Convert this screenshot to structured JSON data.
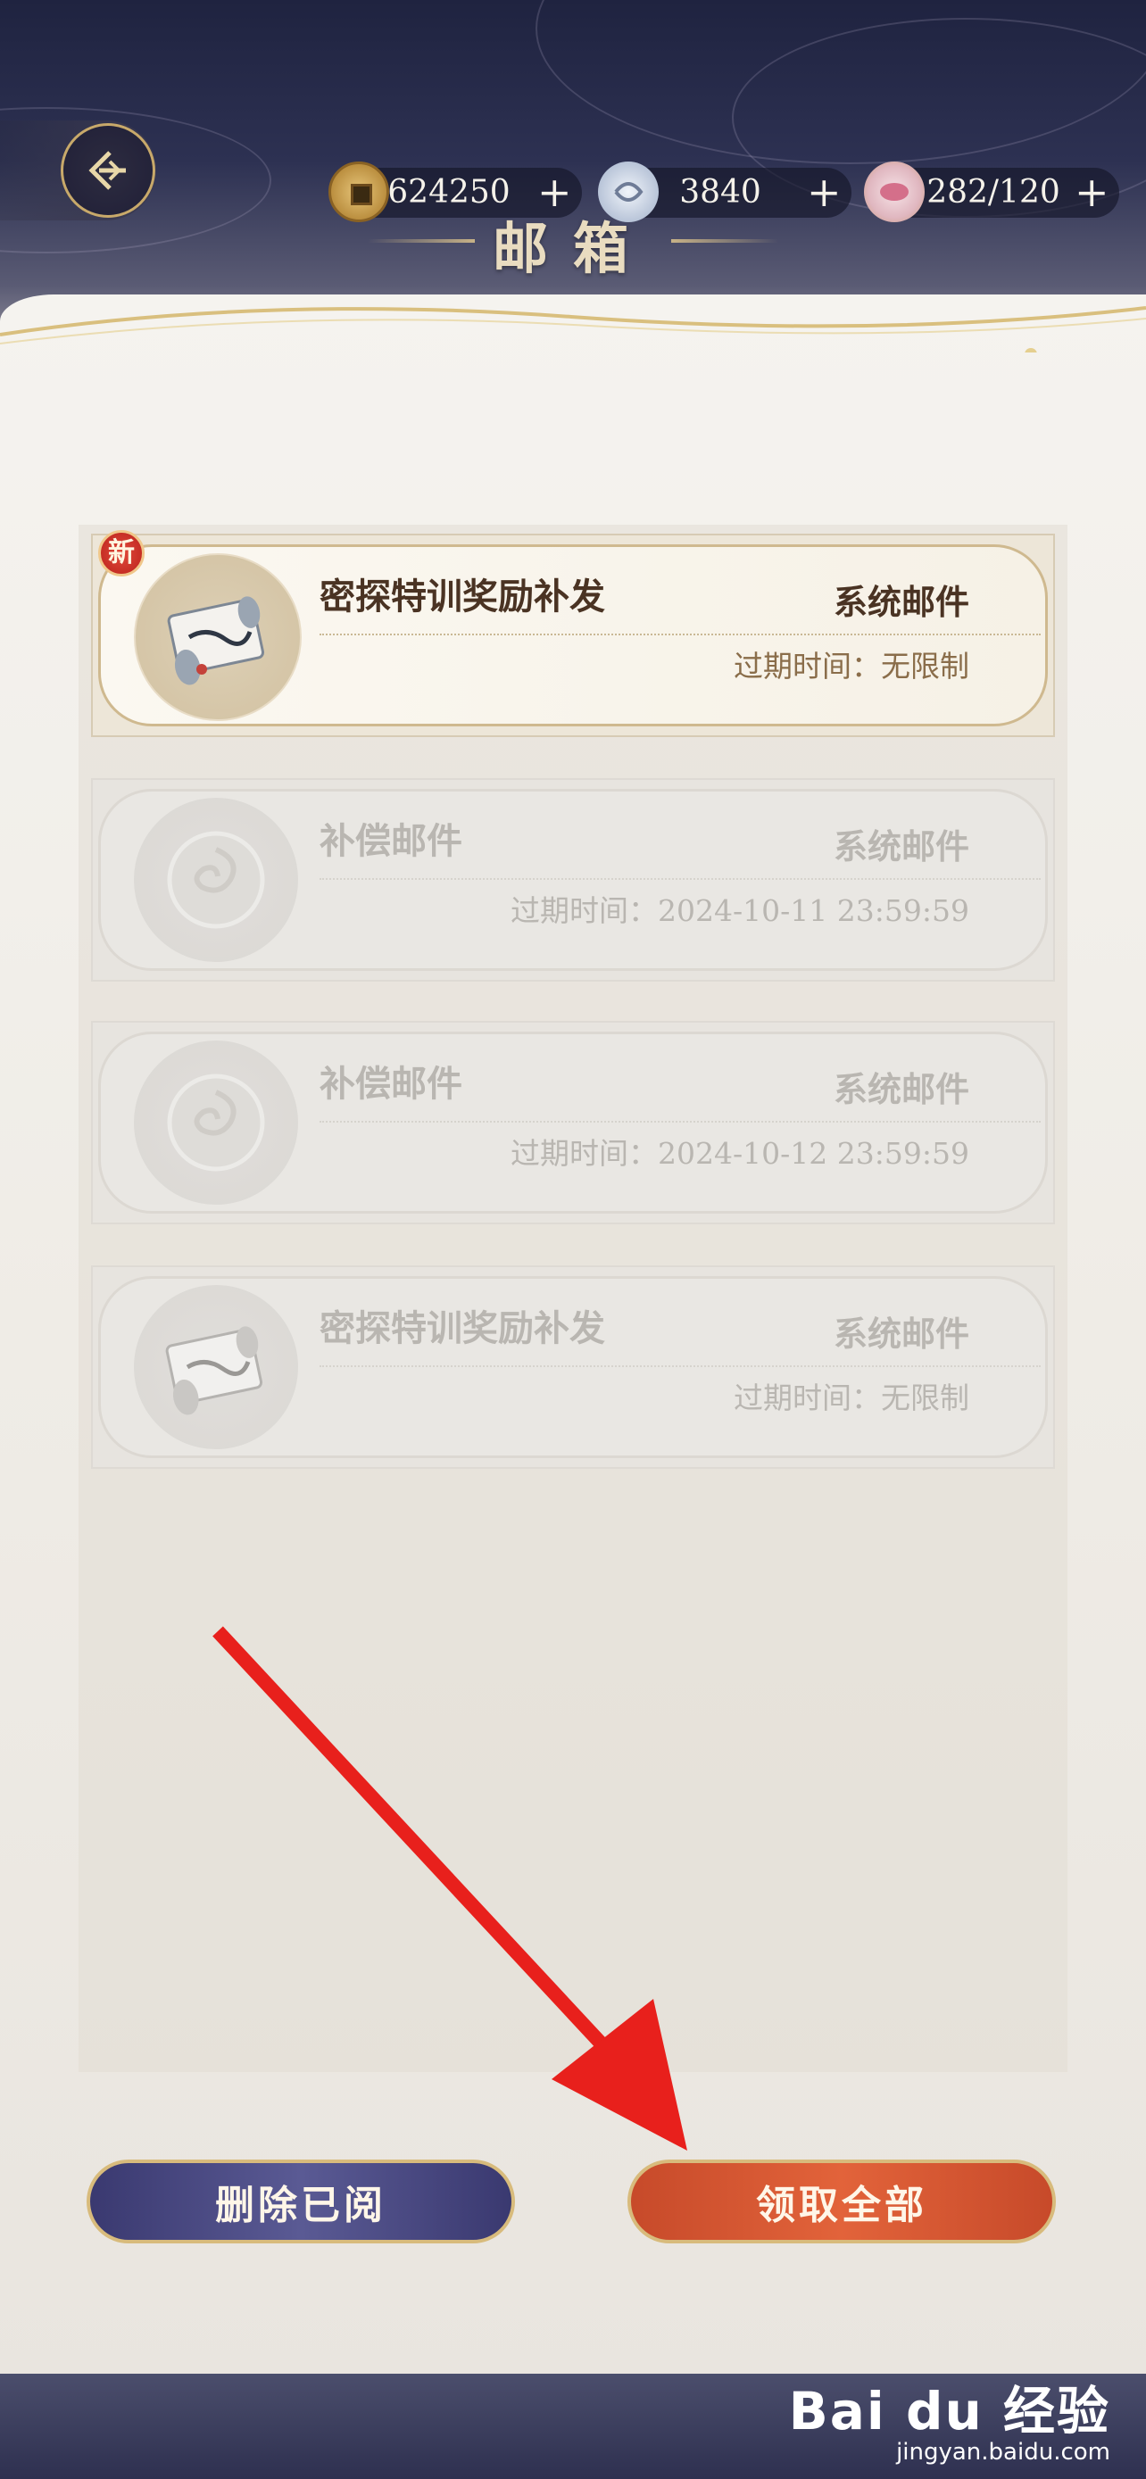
{
  "header": {
    "title": "邮箱",
    "resources": [
      {
        "icon": "copper-coin-icon",
        "value": "624250"
      },
      {
        "icon": "silver-jade-icon",
        "value": "3840"
      },
      {
        "icon": "stamina-bowl-icon",
        "value": "282/120"
      }
    ]
  },
  "mails": [
    {
      "title": "密探特训奖励补发",
      "type": "系统邮件",
      "expiry": "过期时间：无限制",
      "icon": "scroll-icon",
      "badge": "新",
      "state": "unread"
    },
    {
      "title": "补偿邮件",
      "type": "系统邮件",
      "expiry": "过期时间：2024-10-11 23:59:59",
      "icon": "swirl-seal-icon",
      "state": "read"
    },
    {
      "title": "补偿邮件",
      "type": "系统邮件",
      "expiry": "过期时间：2024-10-12 23:59:59",
      "icon": "swirl-seal-icon",
      "state": "read"
    },
    {
      "title": "密探特训奖励补发",
      "type": "系统邮件",
      "expiry": "过期时间：无限制",
      "icon": "scroll-icon",
      "state": "read"
    }
  ],
  "actions": {
    "delete_read": "删除已阅",
    "claim_all": "领取全部"
  },
  "watermark": {
    "main": "Bai du 经验",
    "sub": "jingyan.baidu.com"
  },
  "colors": {
    "claim_button": "#e2633a",
    "delete_button": "#4a4a82",
    "annotation_arrow": "#e8201c"
  }
}
